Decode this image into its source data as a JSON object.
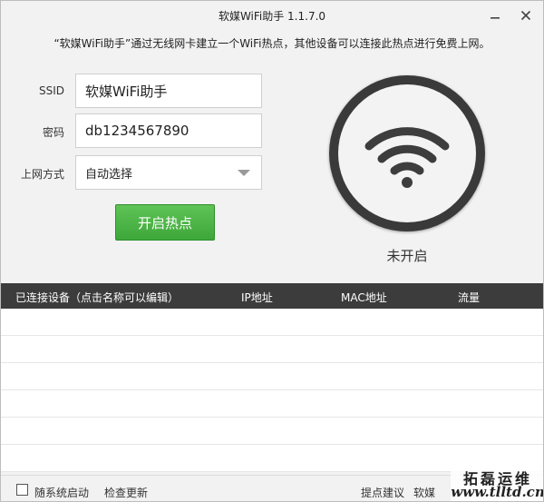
{
  "window": {
    "title": "软媒WiFi助手 1.1.7.0"
  },
  "intro": "“软媒WiFi助手”通过无线网卡建立一个WiFi热点，其他设备可以连接此热点进行免费上网。",
  "form": {
    "ssid_label": "SSID",
    "ssid_value": "软媒WiFi助手",
    "password_label": "密码",
    "password_value": "db1234567890",
    "mode_label": "上网方式",
    "mode_value": "自动选择"
  },
  "start_button": "开启热点",
  "wifi_status": "未开启",
  "table": {
    "headers": [
      "已连接设备（点击名称可以编辑）",
      "IP地址",
      "MAC地址",
      "流量"
    ],
    "rows": []
  },
  "footer": {
    "autostart_label": "随系统启动",
    "check_update": "检查更新",
    "feedback": "提点建议",
    "brand_partial": "软媒"
  },
  "watermark": {
    "line1": "拓磊运维",
    "line2": "www.tlltd.cn"
  },
  "colors": {
    "accent_green": "#3ea73a",
    "header_dark": "#3c3c3c",
    "wifi_ring": "#3a3a3a"
  },
  "icons": {
    "minimize": "minimize-icon",
    "close": "close-icon",
    "wifi": "wifi-icon",
    "dropdown": "chevron-down-icon"
  }
}
